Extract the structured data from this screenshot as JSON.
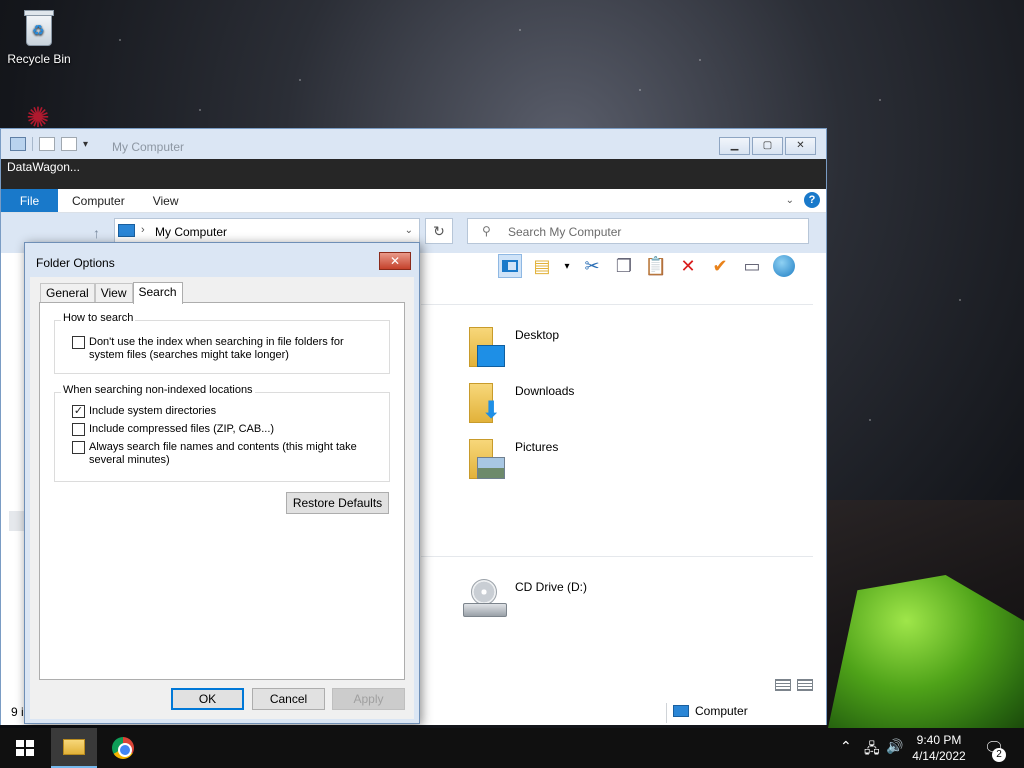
{
  "desktop": {
    "recycle_bin_label": "Recycle Bin"
  },
  "explorer": {
    "title": "My Computer",
    "app_label": "DataWagon...",
    "ribbon_tabs": [
      "File",
      "Computer",
      "View"
    ],
    "address": "My Computer",
    "search_placeholder": "Search My Computer",
    "folders": [
      {
        "label": "Desktop"
      },
      {
        "label": "Downloads"
      },
      {
        "label": "Pictures"
      }
    ],
    "drive_label": "CD Drive (D:)",
    "status_count": "9 i",
    "status_location": "Computer"
  },
  "dialog": {
    "title": "Folder Options",
    "close_glyph": "✕",
    "tabs": [
      "General",
      "View",
      "Search"
    ],
    "active_tab": "Search",
    "group1": {
      "label": "How to search",
      "options": [
        {
          "label": "Don't use the index when searching in file folders for system files (searches might take longer)",
          "checked": false
        }
      ]
    },
    "group2": {
      "label": "When searching non-indexed locations",
      "options": [
        {
          "label": "Include system directories",
          "checked": true
        },
        {
          "label": "Include compressed files (ZIP, CAB...)",
          "checked": false
        },
        {
          "label": "Always search file names and contents (this might take several minutes)",
          "checked": false
        }
      ]
    },
    "restore_defaults": "Restore Defaults",
    "ok": "OK",
    "cancel": "Cancel",
    "apply": "Apply"
  },
  "taskbar": {
    "time": "9:40 PM",
    "date": "4/14/2022",
    "notifications": "2"
  },
  "colors": {
    "accent": "#1979ca",
    "default_button_border": "#0078d7",
    "close_button": "#c4412b"
  }
}
